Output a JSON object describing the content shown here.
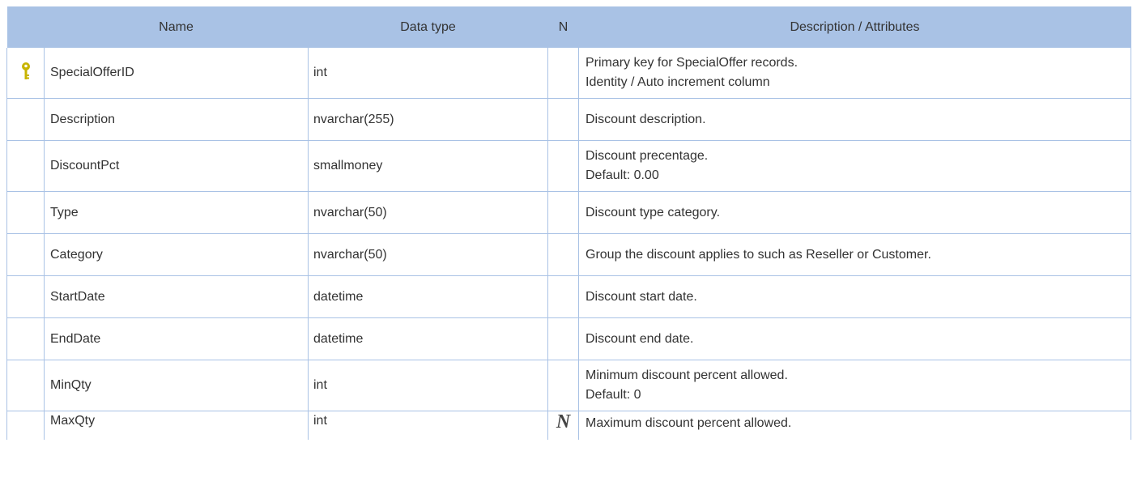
{
  "table": {
    "headers": {
      "name": "Name",
      "data_type": "Data type",
      "nullable": "N",
      "description": "Description / Attributes"
    },
    "rows": [
      {
        "icon": "key-icon",
        "name": "SpecialOfferID",
        "data_type": "int",
        "nullable": "",
        "description": [
          "Primary key for SpecialOffer records.",
          "Identity / Auto increment column"
        ]
      },
      {
        "icon": "",
        "name": "Description",
        "data_type": "nvarchar(255)",
        "nullable": "",
        "description": [
          "Discount description."
        ]
      },
      {
        "icon": "",
        "name": "DiscountPct",
        "data_type": "smallmoney",
        "nullable": "",
        "description": [
          "Discount precentage.",
          "Default: 0.00"
        ]
      },
      {
        "icon": "",
        "name": "Type",
        "data_type": "nvarchar(50)",
        "nullable": "",
        "description": [
          "Discount type category."
        ]
      },
      {
        "icon": "",
        "name": "Category",
        "data_type": "nvarchar(50)",
        "nullable": "",
        "description": [
          "Group the discount applies to such as Reseller or Customer."
        ]
      },
      {
        "icon": "",
        "name": "StartDate",
        "data_type": "datetime",
        "nullable": "",
        "description": [
          "Discount start date."
        ]
      },
      {
        "icon": "",
        "name": "EndDate",
        "data_type": "datetime",
        "nullable": "",
        "description": [
          "Discount end date."
        ]
      },
      {
        "icon": "",
        "name": "MinQty",
        "data_type": "int",
        "nullable": "",
        "description": [
          "Minimum discount percent allowed.",
          "Default: 0"
        ]
      },
      {
        "icon": "",
        "name": "MaxQty",
        "data_type": "int",
        "nullable": "N",
        "description": [
          "Maximum discount percent allowed."
        ]
      }
    ]
  },
  "colors": {
    "header_bg": "#a9c2e5",
    "key_icon": "#c8b400"
  }
}
